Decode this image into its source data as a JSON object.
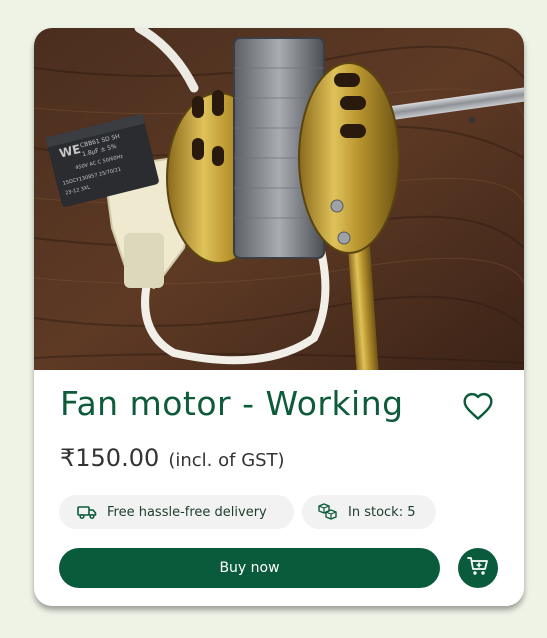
{
  "product": {
    "title": "Fan motor - Working",
    "price": "₹150.00",
    "tax_note": "(incl. of GST)",
    "image_alt": "Fan motor photo",
    "capacitor_text": [
      "CBB61 SD SH",
      "1.8µF ± 5%",
      "450V AC C 50/60Hz",
      "15DCY130857 25/70/21",
      "23-12 3XL"
    ],
    "capacitor_brand": "WE"
  },
  "chips": {
    "delivery": "Free hassle-free delivery",
    "stock": "In stock: 5"
  },
  "actions": {
    "buy_label": "Buy now"
  },
  "icons": {
    "favorite": "heart-outline-icon",
    "delivery": "truck-icon",
    "stock": "boxes-icon",
    "cart": "cart-add-icon"
  },
  "colors": {
    "brand": "#0a5a3c",
    "title": "#0d5b3a",
    "background": "#eef3e6",
    "chip": "#f1f2f1"
  }
}
